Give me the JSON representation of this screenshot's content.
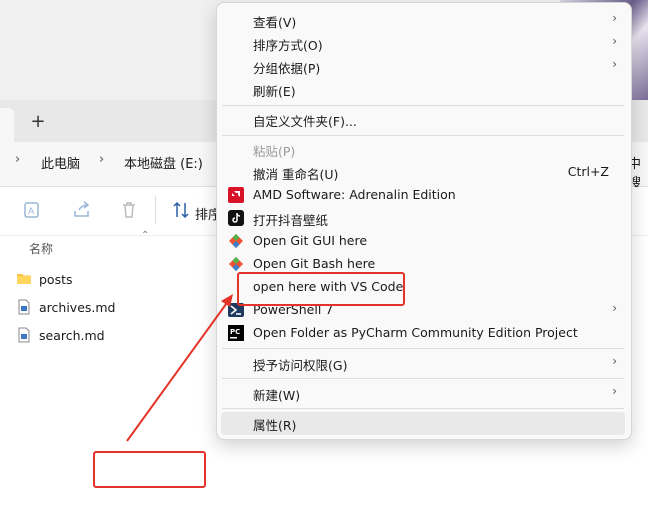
{
  "explorer": {
    "new_tab_label": "+",
    "breadcrumbs": [
      "此电脑",
      "本地磁盘 (E:)"
    ],
    "right_overflow_text": "中搜",
    "sort_label": "排序",
    "column_header": "名称",
    "files": [
      {
        "name": "posts",
        "icon": "folder-icon"
      },
      {
        "name": "archives.md",
        "icon": "file-icon"
      },
      {
        "name": "search.md",
        "icon": "file-icon"
      }
    ]
  },
  "context_menu": {
    "items": [
      {
        "label": "查看(V)",
        "submenu": true
      },
      {
        "label": "排序方式(O)",
        "submenu": true
      },
      {
        "label": "分组依据(P)",
        "submenu": true
      },
      {
        "label": "刷新(E)"
      },
      {
        "label": "自定义文件夹(F)..."
      },
      {
        "label": "粘贴(P)",
        "disabled": true
      },
      {
        "label": "撤消 重命名(U)",
        "accelerator": "Ctrl+Z"
      },
      {
        "label": "AMD Software: Adrenalin Edition",
        "icon": "amd-icon"
      },
      {
        "label": "打开抖音壁纸",
        "icon": "tiktok-icon"
      },
      {
        "label": "Open Git GUI here",
        "icon": "git-icon"
      },
      {
        "label": "Open Git Bash here",
        "icon": "git-icon"
      },
      {
        "label": "open here with VS Code"
      },
      {
        "label": "PowerShell 7",
        "icon": "powershell-icon",
        "submenu": true
      },
      {
        "label": "Open Folder as PyCharm Community Edition Project",
        "icon": "pycharm-icon"
      },
      {
        "label": "授予访问权限(G)",
        "submenu": true
      },
      {
        "label": "新建(W)",
        "submenu": true
      },
      {
        "label": "属性(R)",
        "hover": true
      }
    ]
  },
  "colors": {
    "annotation": "#e4342a",
    "menu_bg": "#f9f9f9",
    "hover": "#e9e9e9"
  }
}
